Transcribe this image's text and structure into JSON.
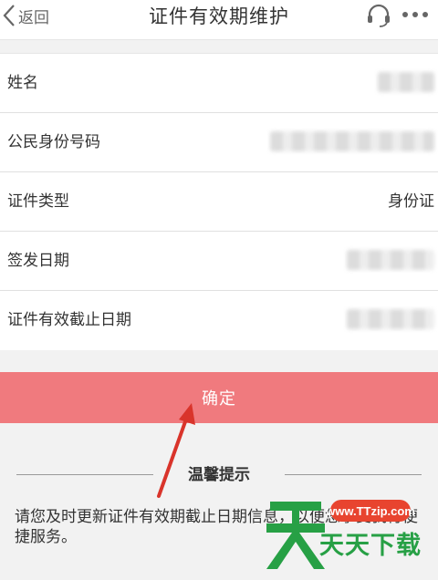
{
  "nav": {
    "back_label": "返回",
    "title": "证件有效期维护",
    "icons": [
      "headset-icon",
      "more-icon"
    ]
  },
  "form": {
    "rows": [
      {
        "label": "姓名",
        "value": ""
      },
      {
        "label": "公民身份号码",
        "value": ""
      },
      {
        "label": "证件类型",
        "value": "身份证"
      },
      {
        "label": "签发日期",
        "value": ""
      },
      {
        "label": "证件有效截止日期",
        "value": ""
      }
    ]
  },
  "confirm_label": "确定",
  "tips": {
    "title": "温馨提示",
    "text": "请您及时更新证件有效期截止日期信息，以便您享受我行便捷服务。"
  },
  "watermark": {
    "url": "www.TTzip.com",
    "text": "天天下载"
  },
  "colors": {
    "accent": "#f07a7e",
    "watermark_green": "#27a045",
    "watermark_red": "#e8442f"
  }
}
